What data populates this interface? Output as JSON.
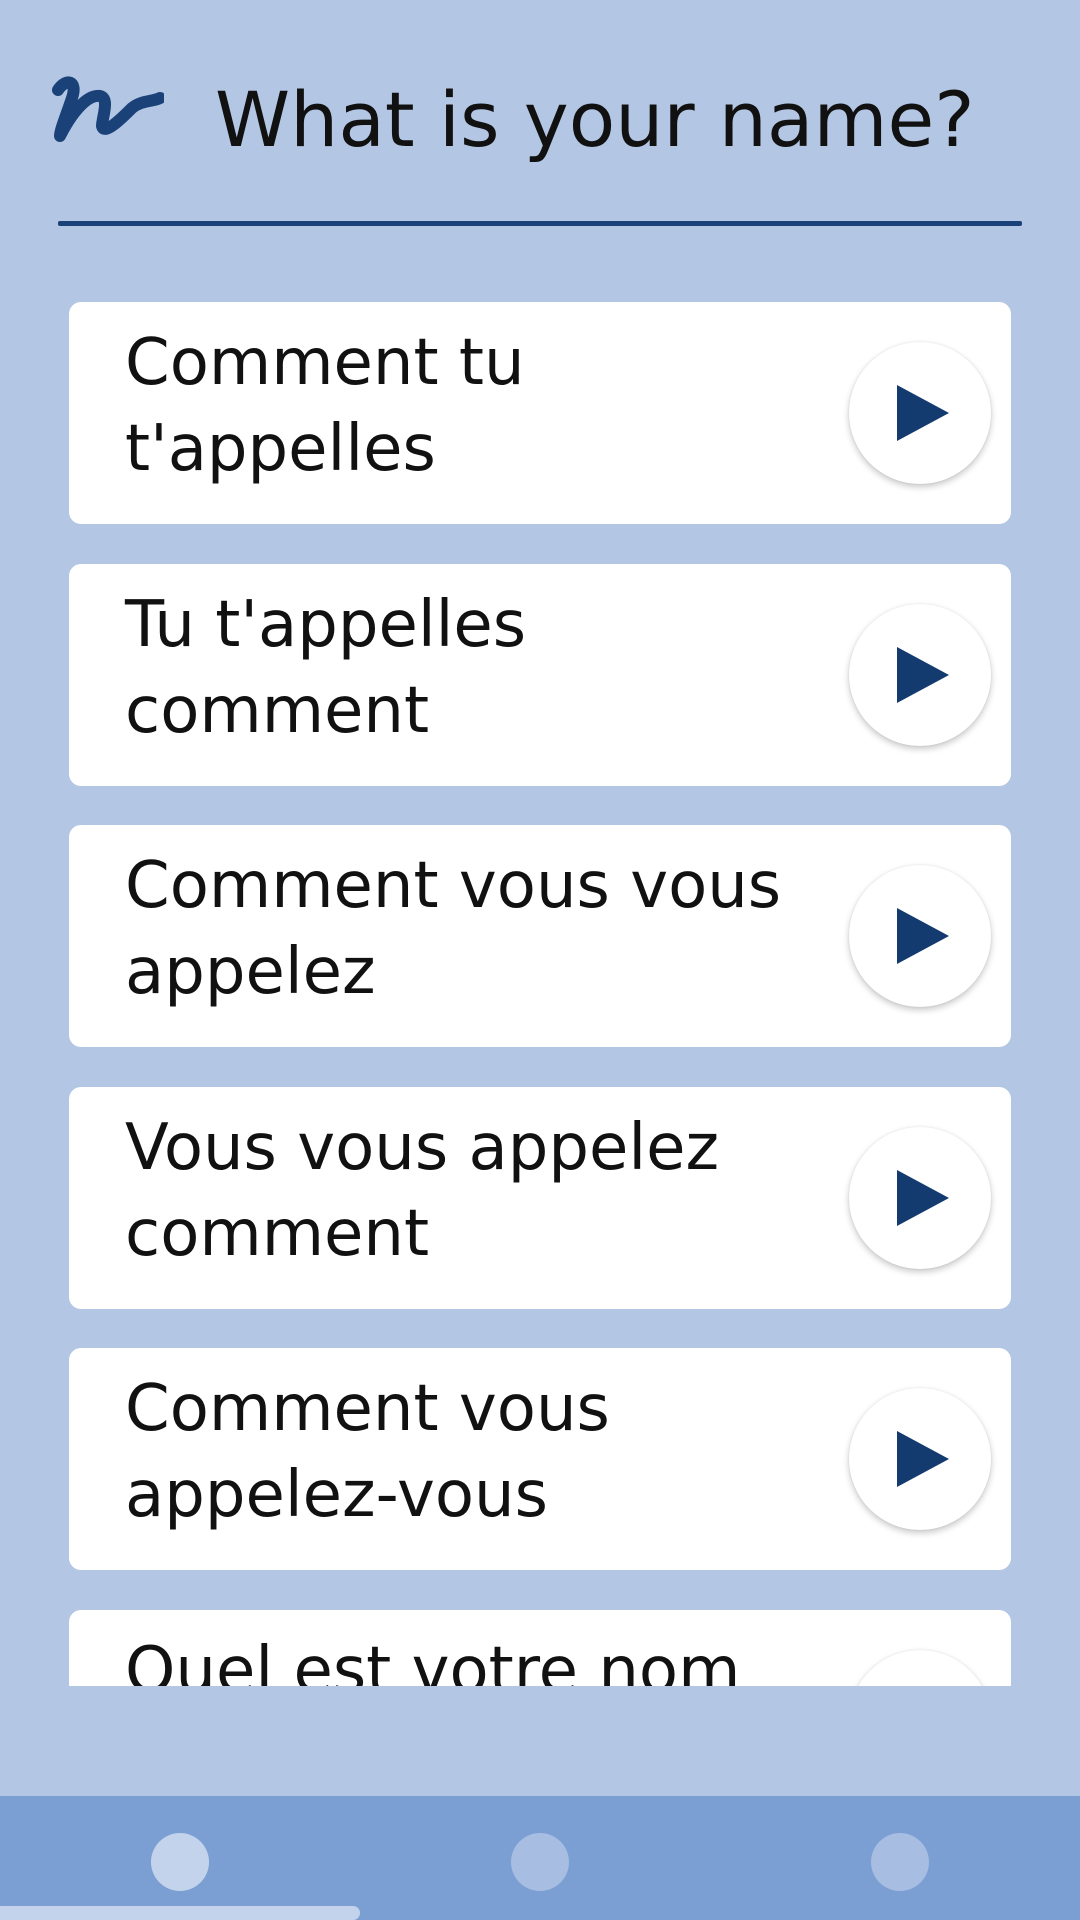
{
  "header": {
    "title": "What is your name?",
    "logo_icon": "handwriting-n-icon"
  },
  "phrases": [
    {
      "text": "Comment tu t'appelles",
      "action_icon": "play-icon"
    },
    {
      "text": "Tu t'appelles comment",
      "action_icon": "play-icon"
    },
    {
      "text": "Comment vous vous appelez",
      "action_icon": "play-icon"
    },
    {
      "text": "Vous vous appelez comment",
      "action_icon": "play-icon"
    },
    {
      "text": "Comment vous appelez-vous",
      "action_icon": "play-icon"
    },
    {
      "text": "Quel est votre nom",
      "action_icon": "play-icon"
    }
  ],
  "bottom_nav": {
    "items": [
      "nav-item-1",
      "nav-item-2",
      "nav-item-3"
    ],
    "active_index": 0
  },
  "colors": {
    "background": "#b3c7e4",
    "accent": "#1a4178",
    "card": "#ffffff",
    "nav_bar": "#7b9fd3"
  }
}
